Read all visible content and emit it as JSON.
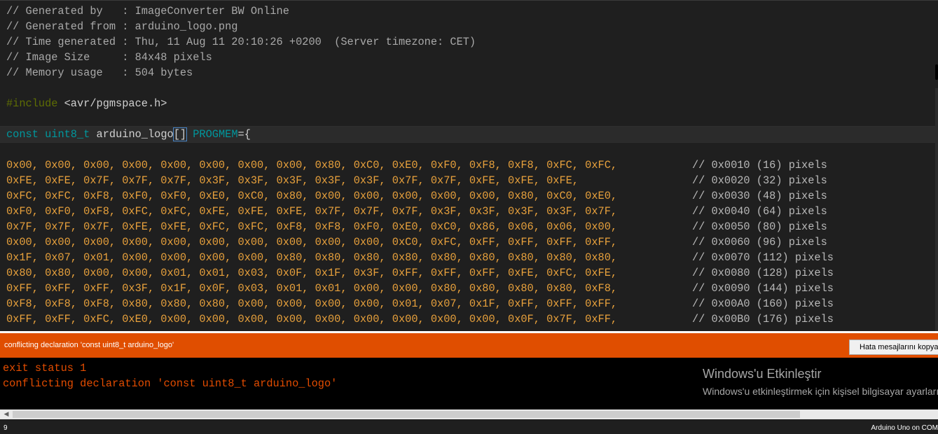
{
  "editor": {
    "header_comments": [
      "// Generated by   : ImageConverter BW Online",
      "// Generated from : arduino_logo.png",
      "// Time generated : Thu, 11 Aug 11 20:10:26 +0200  (Server timezone: CET)",
      "// Image Size     : 84x48 pixels",
      "// Memory usage   : 504 bytes"
    ],
    "include": {
      "directive": "#include",
      "header": " <avr/pgmspace.h>"
    },
    "declaration": {
      "keyword": "const",
      "type": "uint8_t",
      "name": "arduino_logo",
      "brackets": "[]",
      "attribute": "PROGMEM",
      "tail": "={"
    },
    "data_rows": [
      {
        "hex": "0x00, 0x00, 0x00, 0x00, 0x00, 0x00, 0x00, 0x00, 0x80, 0xC0, 0xE0, 0xF0, 0xF8, 0xF8, 0xFC, 0xFC,",
        "comment": "// 0x0010 (16) pixels"
      },
      {
        "hex": "0xFE, 0xFE, 0x7F, 0x7F, 0x7F, 0x3F, 0x3F, 0x3F, 0x3F, 0x3F, 0x7F, 0x7F, 0xFE, 0xFE, 0xFE,",
        "comment": "// 0x0020 (32) pixels"
      },
      {
        "hex": "0xFC, 0xFC, 0xF8, 0xF0, 0xF0, 0xE0, 0xC0, 0x80, 0x00, 0x00, 0x00, 0x00, 0x00, 0x80, 0xC0, 0xE0,",
        "comment": "// 0x0030 (48) pixels"
      },
      {
        "hex": "0xF0, 0xF0, 0xF8, 0xFC, 0xFC, 0xFE, 0xFE, 0xFE, 0x7F, 0x7F, 0x7F, 0x3F, 0x3F, 0x3F, 0x3F, 0x7F,",
        "comment": "// 0x0040 (64) pixels"
      },
      {
        "hex": "0x7F, 0x7F, 0x7F, 0xFE, 0xFE, 0xFC, 0xFC, 0xF8, 0xF8, 0xF0, 0xE0, 0xC0, 0x86, 0x06, 0x06, 0x00,",
        "comment": "// 0x0050 (80) pixels"
      },
      {
        "hex": "0x00, 0x00, 0x00, 0x00, 0x00, 0x00, 0x00, 0x00, 0x00, 0x00, 0xC0, 0xFC, 0xFF, 0xFF, 0xFF, 0xFF,",
        "comment": "// 0x0060 (96) pixels"
      },
      {
        "hex": "0x1F, 0x07, 0x01, 0x00, 0x00, 0x00, 0x00, 0x80, 0x80, 0x80, 0x80, 0x80, 0x80, 0x80, 0x80, 0x80,",
        "comment": "// 0x0070 (112) pixels"
      },
      {
        "hex": "0x80, 0x80, 0x00, 0x00, 0x01, 0x01, 0x03, 0x0F, 0x1F, 0x3F, 0xFF, 0xFF, 0xFF, 0xFE, 0xFC, 0xFE,",
        "comment": "// 0x0080 (128) pixels"
      },
      {
        "hex": "0xFF, 0xFF, 0xFF, 0x3F, 0x1F, 0x0F, 0x03, 0x01, 0x01, 0x00, 0x00, 0x80, 0x80, 0x80, 0x80, 0xF8,",
        "comment": "// 0x0090 (144) pixels"
      },
      {
        "hex": "0xF8, 0xF8, 0xF8, 0x80, 0x80, 0x80, 0x00, 0x00, 0x00, 0x00, 0x01, 0x07, 0x1F, 0xFF, 0xFF, 0xFF,",
        "comment": "// 0x00A0 (160) pixels"
      },
      {
        "hex": "0xFF, 0xFF, 0xFC, 0xE0, 0x00, 0x00, 0x00, 0x00, 0x00, 0x00, 0x00, 0x00, 0x00, 0x0F, 0x7F, 0xFF,",
        "comment": "// 0x00B0 (176) pixels"
      }
    ]
  },
  "status_bar": {
    "message": "conflicting declaration 'const uint8_t arduino_logo'",
    "copy_button_label": "Hata mesajlarını kopyala",
    "color": "#e04e00"
  },
  "console": {
    "lines": [
      "exit status 1",
      "conflicting declaration 'const uint8_t arduino_logo'"
    ],
    "text_color": "#e34c00"
  },
  "activation_watermark": {
    "title": "Windows'u Etkinleştir",
    "subtitle": "Windows'u etkinleştirmek için kişisel bilgisayar ayarlarına gidin."
  },
  "footer": {
    "line_number": "9",
    "board": "Arduino Uno on COM"
  }
}
